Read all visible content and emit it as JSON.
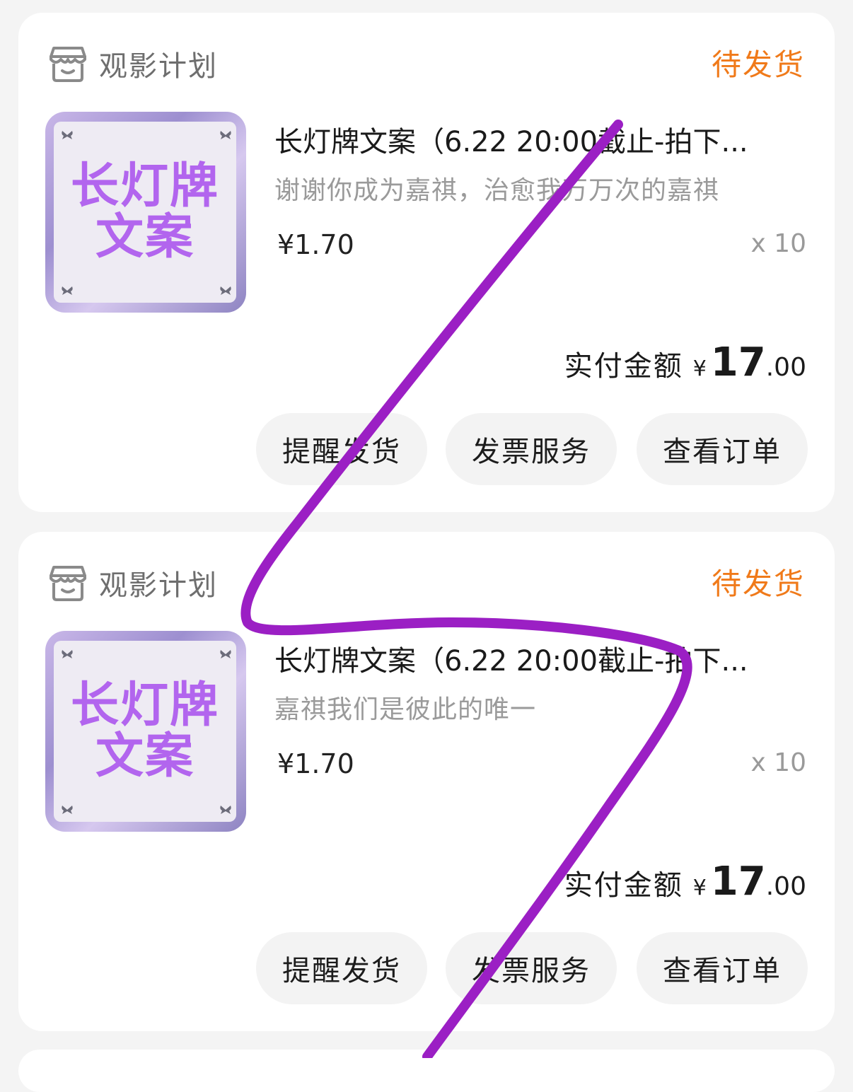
{
  "orders": [
    {
      "shop_name": "观影计划",
      "status": "待发货",
      "thumbnail_text": [
        "长灯牌",
        "文案"
      ],
      "product_title": "长灯牌文案（6.22 20:00截止-拍下...",
      "product_note": "谢谢你成为嘉祺，治愈我万万次的嘉祺",
      "unit_price": "¥1.70",
      "quantity": "x 10",
      "total_label": "实付金额",
      "total_currency": "¥",
      "total_int": "17",
      "total_dec": ".00",
      "buttons": [
        "提醒发货",
        "发票服务",
        "查看订单"
      ]
    },
    {
      "shop_name": "观影计划",
      "status": "待发货",
      "thumbnail_text": [
        "长灯牌",
        "文案"
      ],
      "product_title": "长灯牌文案（6.22 20:00截止-拍下...",
      "product_note": "嘉祺我们是彼此的唯一",
      "unit_price": "¥1.70",
      "quantity": "x 10",
      "total_label": "实付金额",
      "total_currency": "¥",
      "total_int": "17",
      "total_dec": ".00",
      "buttons": [
        "提醒发货",
        "发票服务",
        "查看订单"
      ]
    }
  ],
  "colors": {
    "status": "#f07a1a",
    "thumb_text": "#b265ee",
    "scribble": "#9b1fc4"
  },
  "icons": [
    "store-icon",
    "butterfly-icon"
  ]
}
